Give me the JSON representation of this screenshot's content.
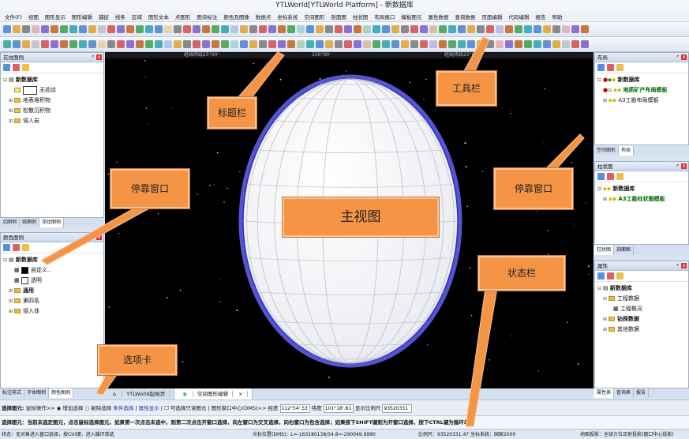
{
  "app": {
    "title": "YTLWorld[YTLWorld Platform] - 新数据库"
  },
  "menu": [
    "文件(F)",
    "视图",
    "图形显示",
    "图形编辑",
    "捕捉",
    "线条",
    "区域",
    "图形文本",
    "点图形",
    "图块标注",
    "颜色及图像",
    "数据点",
    "坐标系统",
    "空间图形",
    "剖面图",
    "柱状图",
    "布局报口",
    "模板图元",
    "属性数据",
    "查询数据",
    "页面编辑",
    "代码编辑",
    "报告",
    "帮助"
  ],
  "ruler": {
    "left_label": "经线纬线25°00'",
    "mid_label": "100°00'",
    "right_label": "经线纬线25°00'"
  },
  "left_top_panel": {
    "title": "花纹图例",
    "root": "新数据库",
    "items": [
      "无花纹",
      "地表堆积物",
      "松散沉积物",
      "侵入岩"
    ],
    "tabs": [
      "点图例",
      "线图例",
      "花纹图例"
    ]
  },
  "left_bottom_panel": {
    "title": "颜色图例",
    "root": "新数据库",
    "items": [
      "自定义..",
      "透明",
      "通用",
      "第四系",
      "侵入体"
    ],
    "tabs": [
      "标注样式",
      "字体图例",
      "颜色图例"
    ]
  },
  "right_layout_panel": {
    "title": "布局",
    "root": "新数据库",
    "items": [
      "地质矿产布局模板",
      "A3工勘布局模板"
    ],
    "tabs": [
      "空间图形",
      "布局"
    ]
  },
  "right_column_panel": {
    "title": "柱状图",
    "root": "新数据库",
    "items": [
      "A3工勘柱状图模板"
    ],
    "tabs": [
      "柱状图",
      "剖面图"
    ]
  },
  "right_props_panel": {
    "title": "属性",
    "root": "新数据库",
    "items": [
      "工程数据",
      "工程概况",
      "钻探数据",
      "其他数据"
    ],
    "tabs": [
      "属性表",
      "查询表",
      "报告"
    ]
  },
  "callouts": {
    "title_bar": "标题栏",
    "toolbar": "工具栏",
    "dock_left": "停靠窗口",
    "dock_right": "停靠窗口",
    "main_view": "主视图",
    "status_bar": "状态栏",
    "tab_card": "选项卡"
  },
  "doc_tabs": [
    "YTLWorld起始页",
    "空间图形编辑"
  ],
  "selection_row": {
    "label": "选择图元:",
    "op_label": "鼠标操作>>",
    "opt1": "增加选择",
    "opt2": "剔除选择",
    "opt3": "条件选择",
    "opt4": "属性显示",
    "opt5": "可选择只读图元",
    "center_label": "图形窗口中心(DMS)>>",
    "lon_label": "经度",
    "lon_value": "112°54'.53",
    "lat_label": "纬度",
    "lat_value": "101°18'.81",
    "scale_label": "显示比例尺",
    "scale_value": "93520331"
  },
  "hint_row": "选择图元：当前未选定图元，点击鼠标选择图元，如果第一次点击未选中，则第二次点击开窗口选择，向左窗口为交叉选择，向右窗口为包含选择；如果按下SHIFT键则为开窗口选择，按下CTRL键为循环单选",
  "status": {
    "left": "状态：无对象进入窗口选择，按Ctrl键，进入循环单选",
    "mouse": "光标位置(DMS)：L=-163180138/54.8=-290049.9990",
    "scale": "比例尺：93520331.47 坐标系统：国家2000",
    "proj": "地图投影：全球方位正射投影(窗口中心投影)"
  }
}
